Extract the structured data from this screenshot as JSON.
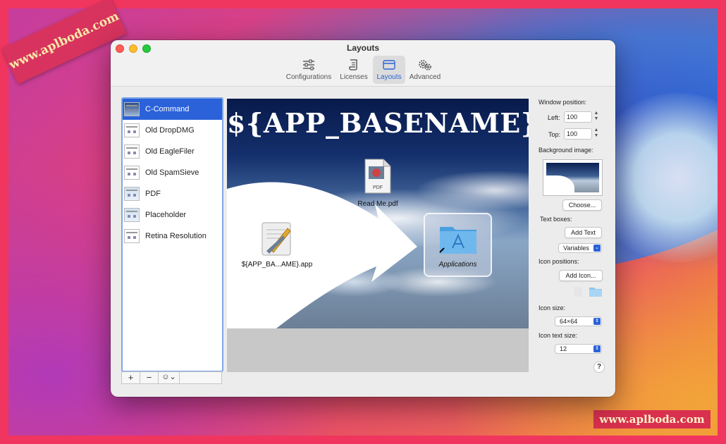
{
  "window": {
    "title": "Layouts"
  },
  "toolbar": {
    "tabs": [
      {
        "label": "Configurations",
        "icon": "sliders-icon"
      },
      {
        "label": "Licenses",
        "icon": "scroll-icon"
      },
      {
        "label": "Layouts",
        "icon": "window-icon",
        "selected": true
      },
      {
        "label": "Advanced",
        "icon": "gears-icon"
      }
    ]
  },
  "layouts_list": {
    "items": [
      {
        "label": "C-Command",
        "selected": true
      },
      {
        "label": "Old DropDMG"
      },
      {
        "label": "Old EagleFiler"
      },
      {
        "label": "Old SpamSieve"
      },
      {
        "label": "PDF"
      },
      {
        "label": "Placeholder"
      },
      {
        "label": "Retina Resolution"
      }
    ],
    "add_label": "+",
    "remove_label": "−",
    "action_label": "☺⌄"
  },
  "preview": {
    "title": "${APP_BASENAME}",
    "readme_label": "Read Me.pdf",
    "app_label": "${APP_BA...AME}.app",
    "applications_label": "Applications"
  },
  "settings": {
    "window_position_label": "Window position:",
    "left_label": "Left:",
    "left_value": "100",
    "top_label": "Top:",
    "top_value": "100",
    "background_image_label": "Background image:",
    "choose_label": "Choose...",
    "text_boxes_label": "Text boxes:",
    "add_text_label": "Add Text",
    "variables_label": "Variables",
    "icon_positions_label": "Icon positions:",
    "add_icon_label": "Add Icon...",
    "icon_size_label": "Icon size:",
    "icon_size_value": "64×64",
    "icon_text_size_label": "Icon text size:",
    "icon_text_size_value": "12",
    "help_label": "?"
  },
  "watermarks": {
    "top_left": "www.aplboda.com",
    "bottom_right": "www.aplboda.com"
  },
  "colors": {
    "accent": "#2b62d9",
    "close": "#fd5f57",
    "minimize": "#febc2e",
    "maximize": "#28c840"
  }
}
